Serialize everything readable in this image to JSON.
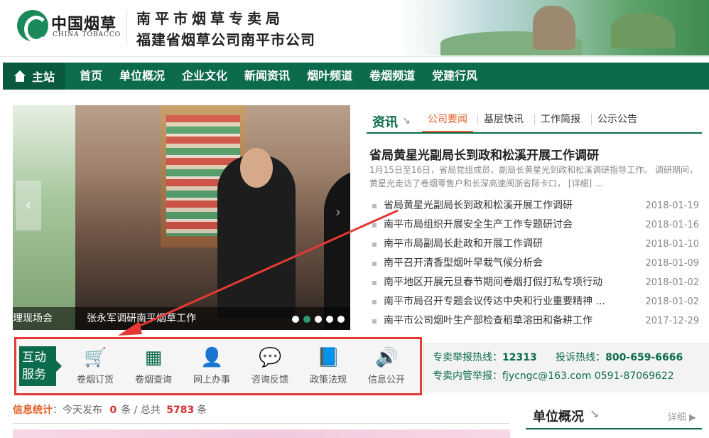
{
  "header": {
    "logo_cn": "中国烟草",
    "logo_en": "CHINA TOBACCO",
    "org_line1": "南平市烟草专卖局",
    "org_line2": "福建省烟草公司南平市公司"
  },
  "nav": {
    "home": "主站",
    "items": [
      "首页",
      "单位概况",
      "企业文化",
      "新闻资讯",
      "烟叶频道",
      "卷烟频道",
      "党建行风"
    ]
  },
  "slider": {
    "prev_caption": "理现场会",
    "caption": "张永军调研南平烟草工作",
    "dot_count": 5,
    "active_dot": 1,
    "prev_arrow": "‹",
    "next_arrow": "›"
  },
  "news": {
    "section_label": "资讯",
    "tabs": [
      "公司要闻",
      "基层快讯",
      "工作简报",
      "公示公告"
    ],
    "active_tab": 0,
    "headline": "省局黄星光副局长到政和松溪开展工作调研",
    "summary": "1月15日至16日，省局党组成员、副局长黄星光到政和松溪调研指导工作。 调研期间，黄星光走访了卷烟零售户和长深高速闽浙省际卡口， [详细] ...",
    "items": [
      {
        "title": "省局黄星光副局长到政和松溪开展工作调研",
        "date": "2018-01-19"
      },
      {
        "title": "南平市局组织开展安全生产工作专题研讨会",
        "date": "2018-01-16"
      },
      {
        "title": "南平市局副局长赴政和开展工作调研",
        "date": "2018-01-10"
      },
      {
        "title": "南平召开清香型烟叶早栽气候分析会",
        "date": "2018-01-09"
      },
      {
        "title": "南平地区开展元旦春节期间卷烟打假打私专项行动",
        "date": "2018-01-02"
      },
      {
        "title": "南平市局召开专题会议传达中央和行业重要精神 ...",
        "date": "2018-01-02"
      },
      {
        "title": "南平市公司烟叶生产部检查稻草溶田和备耕工作",
        "date": "2017-12-29"
      }
    ]
  },
  "services": {
    "tag_line1": "互动",
    "tag_line2": "服务",
    "items": [
      {
        "label": "卷烟订货",
        "icon": "cart-icon",
        "glyph": "🛒"
      },
      {
        "label": "卷烟查询",
        "icon": "grid-icon",
        "glyph": "▦"
      },
      {
        "label": "网上办事",
        "icon": "agent-icon",
        "glyph": "👤"
      },
      {
        "label": "咨询反馈",
        "icon": "chat-icon",
        "glyph": "💬"
      },
      {
        "label": "政策法规",
        "icon": "book-icon",
        "glyph": "📘"
      },
      {
        "label": "信息公开",
        "icon": "speaker-icon",
        "glyph": "🔊"
      }
    ]
  },
  "hotline": {
    "label1": "专卖举报热线：",
    "value1": "12313",
    "label2": "投诉热线：",
    "value2": "800-659-6666",
    "label3": "专卖内管举报：",
    "value3": "fjycngc@163.com  0591-87069622"
  },
  "stats": {
    "label": "信息统计",
    "today_text": "：今天发布",
    "today_count": "0",
    "unit1": "条 / 总共",
    "total": "5783",
    "unit2": "条"
  },
  "unit": {
    "title": "单位概况",
    "more": "详细"
  },
  "colors": {
    "primary": "#0b6b4c",
    "accent": "#e2612a",
    "annotation": "#e53935"
  }
}
